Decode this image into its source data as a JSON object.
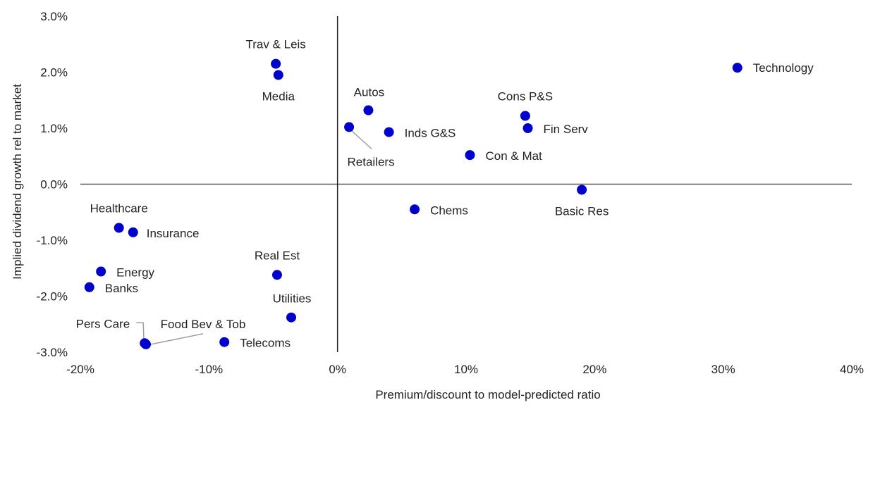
{
  "chart_data": {
    "type": "scatter",
    "title": "",
    "xlabel": "Premium/discount to model-predicted ratio",
    "ylabel": "Implied dividend growth rel to market",
    "xlim": [
      -20,
      40
    ],
    "ylim": [
      -3.0,
      3.0
    ],
    "x_unit": "%",
    "y_unit": "%",
    "x_ticks": [
      -20,
      -10,
      0,
      10,
      20,
      30,
      40
    ],
    "x_tick_labels": [
      "-20%",
      "-10%",
      "0%",
      "10%",
      "20%",
      "30%",
      "40%"
    ],
    "y_ticks": [
      3.0,
      2.0,
      1.0,
      0.0,
      -1.0,
      -2.0,
      -3.0
    ],
    "y_tick_labels": [
      "3.0%",
      "2.0%",
      "1.0%",
      "0.0%",
      "-1.0%",
      "-2.0%",
      "-3.0%"
    ],
    "grid": false,
    "legend": "none",
    "marker_color": "#0000cc",
    "points": [
      {
        "label": "Technology",
        "x": 31.1,
        "y": 2.08
      },
      {
        "label": "Trav & Leis",
        "x": -4.8,
        "y": 2.15
      },
      {
        "label": "Media",
        "x": -4.6,
        "y": 1.95
      },
      {
        "label": "Autos",
        "x": 2.4,
        "y": 1.32
      },
      {
        "label": "Retailers",
        "x": 0.9,
        "y": 1.02
      },
      {
        "label": "Inds G&S",
        "x": 4.0,
        "y": 0.93
      },
      {
        "label": "Cons P&S",
        "x": 14.6,
        "y": 1.22
      },
      {
        "label": "Fin Serv",
        "x": 14.8,
        "y": 1.0
      },
      {
        "label": "Con & Mat",
        "x": 10.3,
        "y": 0.52
      },
      {
        "label": "Chems",
        "x": 6.0,
        "y": -0.45
      },
      {
        "label": "Basic Res",
        "x": 19.0,
        "y": -0.1
      },
      {
        "label": "Healthcare",
        "x": -17.0,
        "y": -0.78
      },
      {
        "label": "Insurance",
        "x": -15.9,
        "y": -0.86
      },
      {
        "label": "Energy",
        "x": -18.4,
        "y": -1.56
      },
      {
        "label": "Banks",
        "x": -19.3,
        "y": -1.84
      },
      {
        "label": "Real Est",
        "x": -4.7,
        "y": -1.62
      },
      {
        "label": "Utilities",
        "x": -3.6,
        "y": -2.38
      },
      {
        "label": "Telecoms",
        "x": -8.8,
        "y": -2.82
      },
      {
        "label": "Pers Care",
        "x": -15.0,
        "y": -2.84
      },
      {
        "label": "Food Bev & Tob",
        "x": -14.9,
        "y": -2.86
      }
    ]
  }
}
